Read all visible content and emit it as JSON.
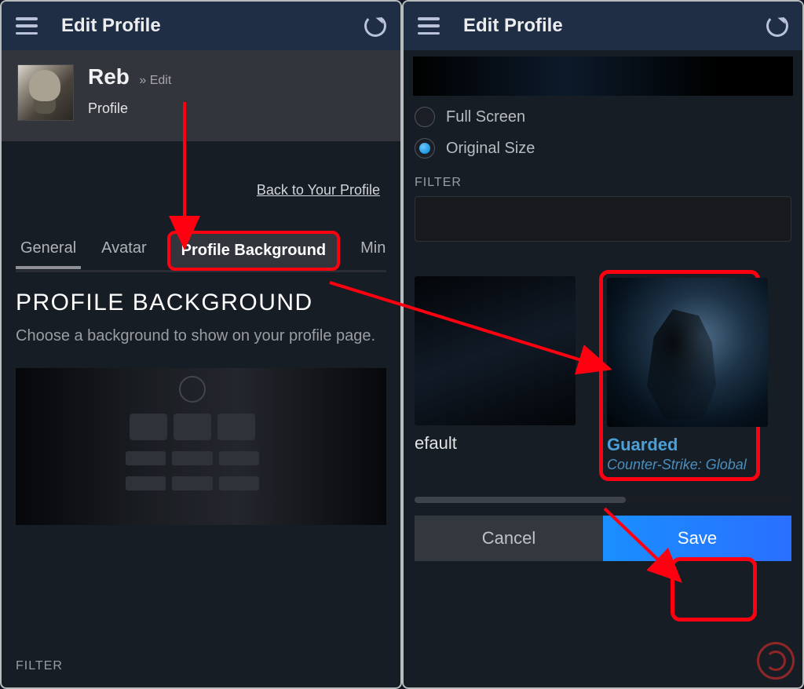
{
  "header": {
    "title": "Edit Profile"
  },
  "profile": {
    "name": "Reb",
    "sep": "» Edit",
    "sub": "Profile"
  },
  "back_link": "Back to Your Profile",
  "tabs": {
    "general": "General",
    "avatar": "Avatar",
    "profile_bg": "Profile Background",
    "min": "Min"
  },
  "section": {
    "heading": "PROFILE BACKGROUND",
    "desc": "Choose a background to show on your profile page."
  },
  "filter_label": "FILTER",
  "size_options": {
    "full": "Full Screen",
    "original": "Original Size"
  },
  "backgrounds": {
    "default_label": "efault",
    "guarded": {
      "title": "Guarded",
      "game": "Counter-Strike: Global"
    }
  },
  "buttons": {
    "cancel": "Cancel",
    "save": "Save"
  }
}
